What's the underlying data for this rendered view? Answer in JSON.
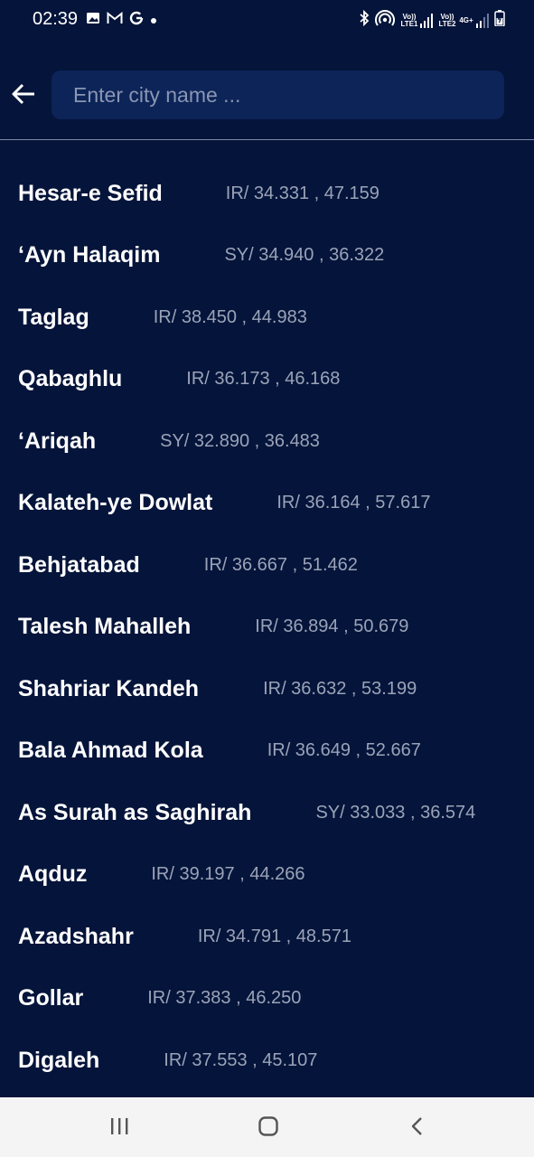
{
  "status_bar": {
    "time": "02:39",
    "sim1_label": "Vo)) LTE1",
    "sim2_label": "Vo)) LTE2",
    "network_label": "4G+"
  },
  "search": {
    "placeholder": "Enter city name ...",
    "value": ""
  },
  "cities": [
    {
      "name": "Hesar-e Sefid",
      "coords": "IR/ 34.331 , 47.159",
      "gap": 70
    },
    {
      "name": "‘Ayn Halaqim",
      "coords": "SY/ 34.940 , 36.322",
      "gap": 71
    },
    {
      "name": "Taglag",
      "coords": "IR/ 38.450 , 44.983",
      "gap": 71
    },
    {
      "name": "Qabaghlu",
      "coords": "IR/ 36.173 , 46.168",
      "gap": 71
    },
    {
      "name": "‘Ariqah",
      "coords": "SY/ 32.890 , 36.483",
      "gap": 71
    },
    {
      "name": "Kalateh-ye Dowlat",
      "coords": "IR/ 36.164 , 57.617",
      "gap": 71
    },
    {
      "name": "Behjatabad",
      "coords": "IR/ 36.667 , 51.462",
      "gap": 71
    },
    {
      "name": "Talesh Mahalleh",
      "coords": "IR/ 36.894 , 50.679",
      "gap": 71
    },
    {
      "name": "Shahriar Kandeh",
      "coords": "IR/ 36.632 , 53.199",
      "gap": 71
    },
    {
      "name": "Bala Ahmad Kola",
      "coords": "IR/ 36.649 , 52.667",
      "gap": 71
    },
    {
      "name": "As Surah as Saghirah",
      "coords": "SY/ 33.033 , 36.574",
      "gap": 71
    },
    {
      "name": "Aqduz",
      "coords": "IR/ 39.197 , 44.266",
      "gap": 71
    },
    {
      "name": "Azadshahr",
      "coords": "IR/ 34.791 , 48.571",
      "gap": 71
    },
    {
      "name": "Gollar",
      "coords": "IR/ 37.383 , 46.250",
      "gap": 71
    },
    {
      "name": "Digaleh",
      "coords": "IR/ 37.553 , 45.107",
      "gap": 71
    }
  ],
  "icons": {
    "back": "arrow-left-icon",
    "recents": "recents-icon",
    "home": "home-icon",
    "nav_back": "chevron-left-icon"
  }
}
